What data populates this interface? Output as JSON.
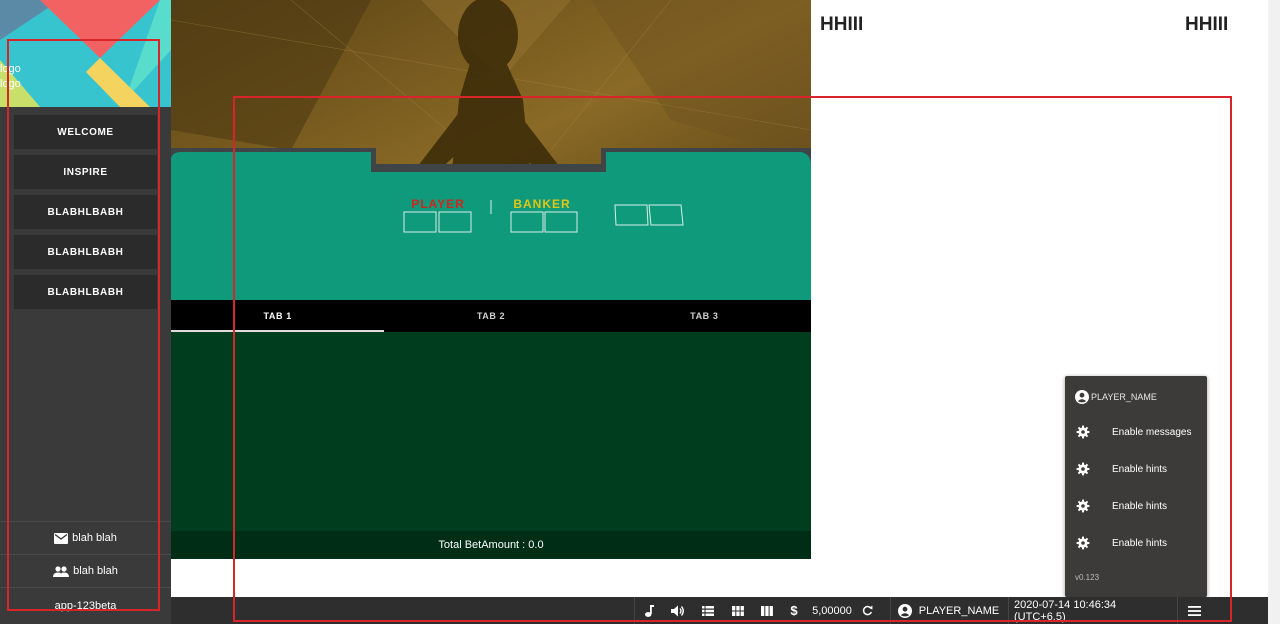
{
  "sidebar": {
    "logo_text_1": "logo",
    "logo_text_2": "logo",
    "nav": [
      {
        "label": "WELCOME"
      },
      {
        "label": "INSPIRE"
      },
      {
        "label": "BLABHLBABH"
      },
      {
        "label": "BLABHLBABH"
      },
      {
        "label": "BLABHLBABH"
      }
    ],
    "footer": {
      "messages_label": "blah blah",
      "users_label": "blah blah",
      "version": "app-123beta"
    }
  },
  "table": {
    "player_label": "PLAYER",
    "banker_label": "BANKER",
    "player_color": "#d0261d",
    "banker_color": "#e4c414",
    "felt_color": "#0e9a7b"
  },
  "tabs": [
    {
      "label": "TAB 1",
      "active": true
    },
    {
      "label": "TAB 2",
      "active": false
    },
    {
      "label": "TAB 3",
      "active": false
    }
  ],
  "total_bet": "Total BetAmount : 0.0",
  "headings": {
    "left": "HHIII",
    "right": "HHIII"
  },
  "popup": {
    "player_name": "PLAYER_NAME",
    "items": [
      {
        "label": "Enable messages",
        "icon": "gear-icon"
      },
      {
        "label": "Enable hints",
        "icon": "gear-icon"
      },
      {
        "label": "Enable hints",
        "icon": "gear-icon"
      },
      {
        "label": "Enable hints",
        "icon": "gear-icon"
      }
    ],
    "version": "v0.123"
  },
  "bottom_bar": {
    "balance": "5,00000",
    "player_name": "PLAYER_NAME",
    "datetime": "2020-07-14 10:46:34 (UTC+6.5)",
    "icons": [
      "music-icon",
      "volume-icon",
      "list-view-icon",
      "grid-view-icon",
      "columns-view-icon",
      "dollar-icon",
      "refresh-icon",
      "account-icon",
      "hamburger-menu-icon"
    ]
  },
  "colors": {
    "annotation_outline": "#d9252a",
    "sidebar_bg": "#3a3a3a",
    "bar_bg": "#2e2e2e"
  }
}
